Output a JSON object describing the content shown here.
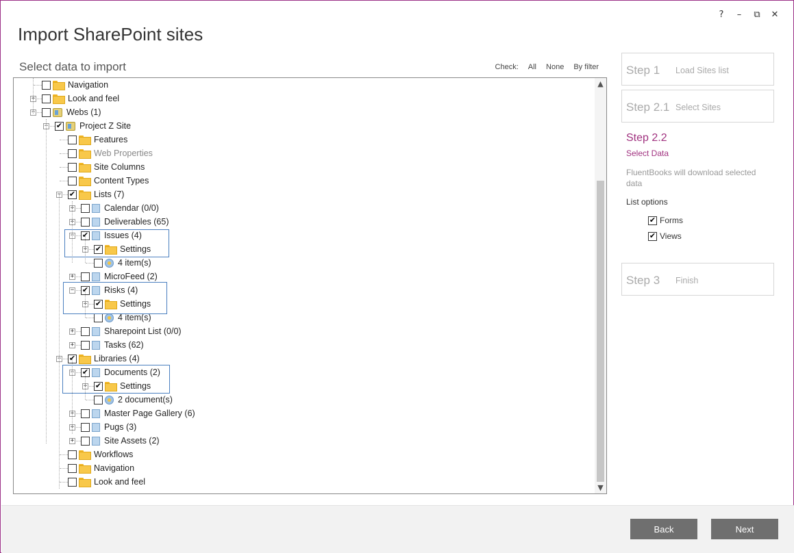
{
  "window": {
    "title": "Import SharePoint sites",
    "buttons": {
      "help": "?",
      "minimize": "–",
      "restore": "⧉",
      "close": "✕"
    }
  },
  "section_label": "Select data to import",
  "check_bar": {
    "label": "Check:",
    "all": "All",
    "none": "None",
    "by_filter": "By filter"
  },
  "tree": [
    {
      "label": "Navigation",
      "icon": "folder-icon",
      "checked": false
    },
    {
      "label": "Look and feel",
      "icon": "folder-icon",
      "checked": false
    },
    {
      "label": "Webs (1)",
      "icon": "web-icon",
      "checked": false
    },
    {
      "label": "Project Z Site",
      "icon": "web-icon",
      "checked": true
    },
    {
      "label": "Features",
      "icon": "folder-icon",
      "checked": false
    },
    {
      "label": "Web Properties",
      "icon": "folder-icon",
      "checked": false,
      "disabled": true
    },
    {
      "label": "Site Columns",
      "icon": "folder-icon",
      "checked": false
    },
    {
      "label": "Content Types",
      "icon": "folder-icon",
      "checked": false
    },
    {
      "label": "Lists (7)",
      "icon": "folder-icon",
      "checked": true
    },
    {
      "label": "Calendar (0/0)",
      "icon": "list-icon",
      "checked": false
    },
    {
      "label": "Deliverables (65)",
      "icon": "list-icon",
      "checked": false
    },
    {
      "label": "Issues (4)",
      "icon": "list-icon",
      "checked": true
    },
    {
      "label": "Settings",
      "icon": "folder-icon",
      "checked": true
    },
    {
      "label": "4 item(s)",
      "icon": "item-icon",
      "checked": false
    },
    {
      "label": "MicroFeed (2)",
      "icon": "list-icon",
      "checked": false
    },
    {
      "label": "Risks (4)",
      "icon": "list-icon",
      "checked": true
    },
    {
      "label": "Settings",
      "icon": "folder-icon",
      "checked": true
    },
    {
      "label": "4 item(s)",
      "icon": "item-icon",
      "checked": false
    },
    {
      "label": "Sharepoint List (0/0)",
      "icon": "list-icon",
      "checked": false
    },
    {
      "label": "Tasks (62)",
      "icon": "list-icon",
      "checked": false
    },
    {
      "label": "Libraries (4)",
      "icon": "folder-icon",
      "checked": true
    },
    {
      "label": "Documents (2)",
      "icon": "list-icon",
      "checked": true
    },
    {
      "label": "Settings",
      "icon": "folder-icon",
      "checked": true
    },
    {
      "label": "2 document(s)",
      "icon": "item-icon",
      "checked": false
    },
    {
      "label": "Master Page Gallery (6)",
      "icon": "list-icon",
      "checked": false
    },
    {
      "label": "Pugs (3)",
      "icon": "list-icon",
      "checked": false
    },
    {
      "label": "Site Assets (2)",
      "icon": "list-icon",
      "checked": false
    },
    {
      "label": "Workflows",
      "icon": "folder-icon",
      "checked": false
    },
    {
      "label": "Navigation",
      "icon": "folder-icon",
      "checked": false
    },
    {
      "label": "Look and feel",
      "icon": "folder-icon",
      "checked": false
    }
  ],
  "steps": {
    "step1": {
      "num": "Step 1",
      "name": "Load Sites list"
    },
    "step21": {
      "num": "Step 2.1",
      "name": "Select Sites"
    },
    "step22": {
      "num": "Step 2.2",
      "name": "Select Data"
    },
    "step22_desc": "FluentBooks will download selected data",
    "list_options_label": "List options",
    "options": [
      {
        "label": "Forms",
        "checked": true
      },
      {
        "label": "Views",
        "checked": true
      }
    ],
    "step3": {
      "num": "Step 3",
      "name": "Finish"
    }
  },
  "footer": {
    "back": "Back",
    "next": "Next"
  },
  "colors": {
    "accent": "#a0317f",
    "button": "#6f6f6f",
    "highlight": "#4a7fbf"
  }
}
